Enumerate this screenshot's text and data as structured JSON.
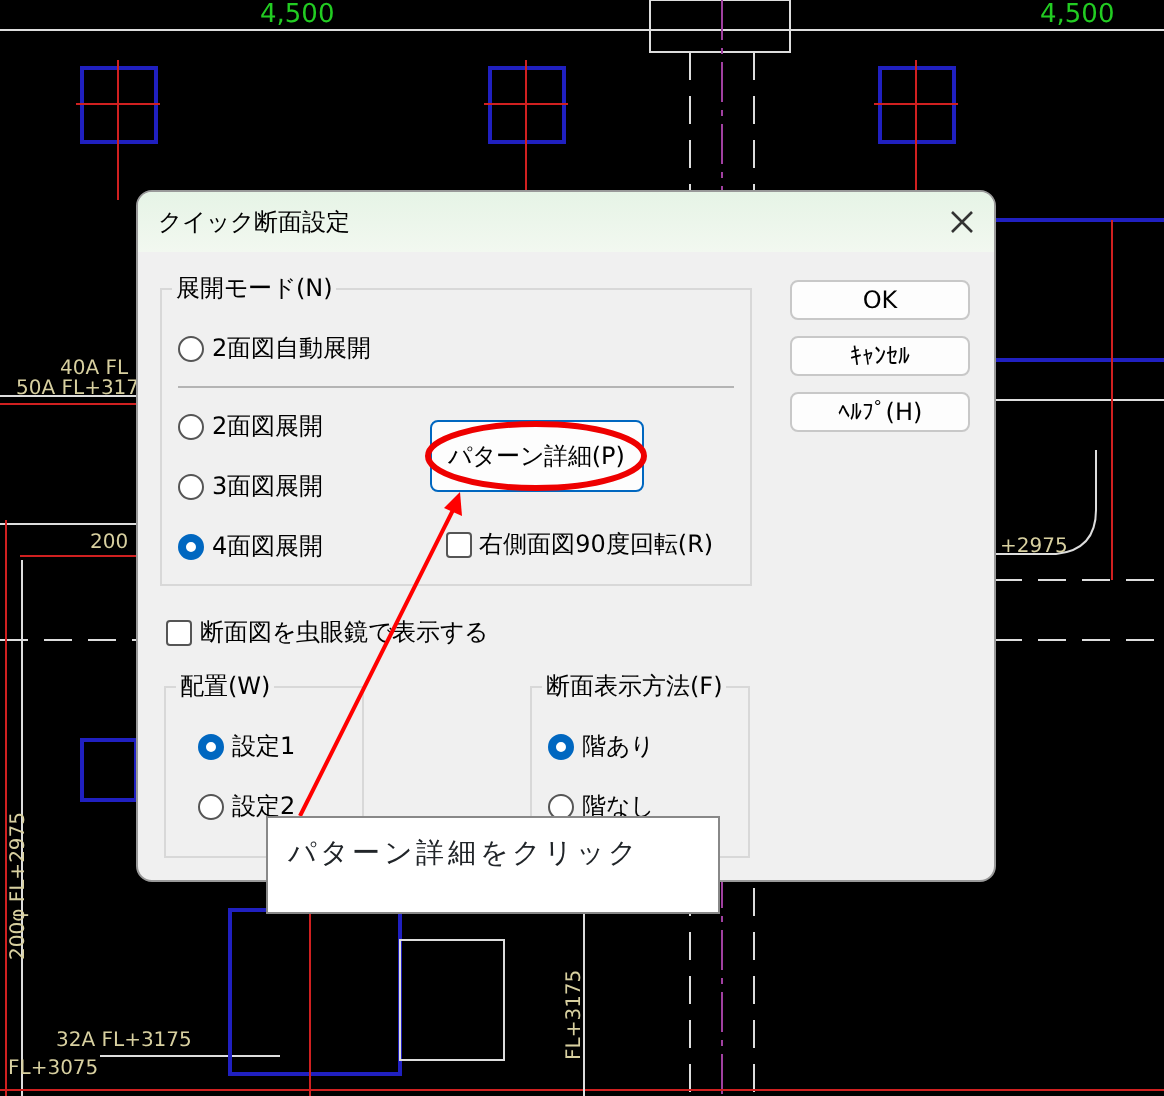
{
  "cad_labels": [
    {
      "text": "4,500",
      "kind": "dimension"
    },
    {
      "text": "4,500",
      "kind": "dimension"
    },
    {
      "text": "40A  FL",
      "kind": "pipe"
    },
    {
      "text": "50A  FL+317",
      "kind": "pipe"
    },
    {
      "text": "200",
      "kind": "pipe"
    },
    {
      "text": "+2975",
      "kind": "pipe"
    },
    {
      "text": "200φ  FL+2975",
      "kind": "vertical"
    },
    {
      "text": "32A  FL+3175",
      "kind": "pipe"
    },
    {
      "text": "FL+3075",
      "kind": "pipe"
    },
    {
      "text": "FL+3175",
      "kind": "vertical"
    }
  ],
  "dialog": {
    "title": "クイック断面設定",
    "expand_mode": {
      "label": "展開モード(N)",
      "options": [
        {
          "label": "2面図自動展開",
          "selected": false
        },
        {
          "label": "2面図展開",
          "selected": false
        },
        {
          "label": "3面図展開",
          "selected": false
        },
        {
          "label": "4面図展開",
          "selected": true
        }
      ],
      "pattern_button": "パターン詳細(P)",
      "rotate_checkbox": {
        "label": "右側面図90度回転(R)",
        "checked": false
      }
    },
    "magnifier_checkbox": {
      "label": "断面図を虫眼鏡で表示する",
      "checked": false
    },
    "layout_group": {
      "label": "配置(W)",
      "options": [
        {
          "label": "設定1",
          "selected": true
        },
        {
          "label": "設定2",
          "selected": false
        }
      ]
    },
    "section_display": {
      "label": "断面表示方法(F)",
      "options": [
        {
          "label": "階あり",
          "selected": true
        },
        {
          "label": "階なし",
          "selected": false
        }
      ]
    },
    "buttons": [
      "OK",
      "ｷｬﾝｾﾙ",
      "ﾍﾙﾌﾟ(H)"
    ]
  },
  "annotation": {
    "callout": "パターン詳細をクリック"
  }
}
